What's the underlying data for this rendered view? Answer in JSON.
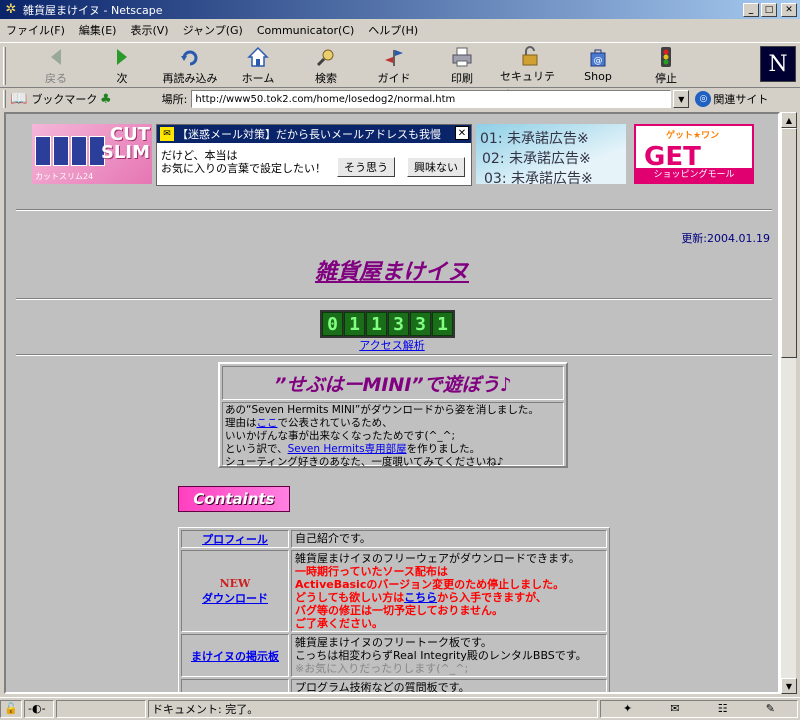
{
  "window": {
    "title": "雑貨屋まけイヌ - Netscape"
  },
  "menu": [
    "ファイル(F)",
    "編集(E)",
    "表示(V)",
    "ジャンプ(G)",
    "Communicator(C)",
    "ヘルプ(H)"
  ],
  "toolbar": {
    "back": "戻る",
    "forward": "次",
    "reload": "再読み込み",
    "home": "ホーム",
    "search": "検索",
    "guide": "ガイド",
    "print": "印刷",
    "security": "セキュリティ",
    "shop": "Shop",
    "stop": "停止"
  },
  "location": {
    "bookmarks": "ブックマーク",
    "label": "場所:",
    "url": "http://www50.tok2.com/home/losedog2/normal.htm",
    "related": "関連サイト"
  },
  "banners": {
    "b1_big": "CUT\nSLIM",
    "b1_small": "カットスリム24",
    "b2_header": "【迷惑メール対策】だから長いメールアドレスも我慢",
    "b2_line1": "だけど、本当は",
    "b2_line2": "お気に入りの言葉で設定したい！",
    "b2_yes": "そう思う",
    "b2_interest": "興味ない",
    "b3_l1": "01: 未承諾広告※",
    "b3_l2": "02: 未承諾広告※",
    "b3_l3": "03: 未承諾広告※",
    "b4_top": "ゲット★ワン",
    "b4_get": "GET",
    "b4_sub": "ショッピングモール"
  },
  "updated": "更新:2004.01.19",
  "site_title": "雑貨屋まけイヌ",
  "counter": [
    "0",
    "1",
    "1",
    "3",
    "3",
    "1"
  ],
  "access_link": "アクセス解析",
  "promo": {
    "heading": "”せぶはーMINI”で遊ぼう♪",
    "l1": "あの“Seven Hermits MINI”がダウンロードから姿を消しました。",
    "l2a": "理由は",
    "l2link": "ここ",
    "l2b": "で公表されているため、",
    "l3": "いいかげんな事が出来なくなったためです(^_^;",
    "l4a": "という訳で、",
    "l4link": "Seven Hermits専用部屋",
    "l4b": "を作りました。",
    "l5": "シューティング好きのあなた、一度覗いてみてくださいね♪"
  },
  "contents_title": "Containts",
  "table": {
    "r1_label": "プロフィール",
    "r1_desc": "自己紹介です。",
    "r2_new": "NEW",
    "r2_label": "ダウンロード",
    "r2_desc": "雑貨屋まけイヌのフリーウェアがダウンロードできます。",
    "r2_red1": "一時期行っていたソース配布は",
    "r2_red2": "ActiveBasicのバージョン変更のため停止しました。",
    "r2_red3a": "どうしても欲しい方は",
    "r2_red3link": "こちら",
    "r2_red3b": "から入手できますが、",
    "r2_red4": "バグ等の修正は一切予定しておりません。",
    "r2_red5": "ご了承ください。",
    "r3_label": "まけイヌの掲示板",
    "r3_d1": "雑貨屋まけイヌのフリートーク板です。",
    "r3_d2": "こっちは相変わらずReal Integrity殿のレンタルBBSです。",
    "r3_d3": "※お気に入りだったりします(^_^;",
    "r4_d1": "プログラム技術などの質問板です。"
  },
  "status": {
    "text": "ドキュメント: 完了。"
  }
}
